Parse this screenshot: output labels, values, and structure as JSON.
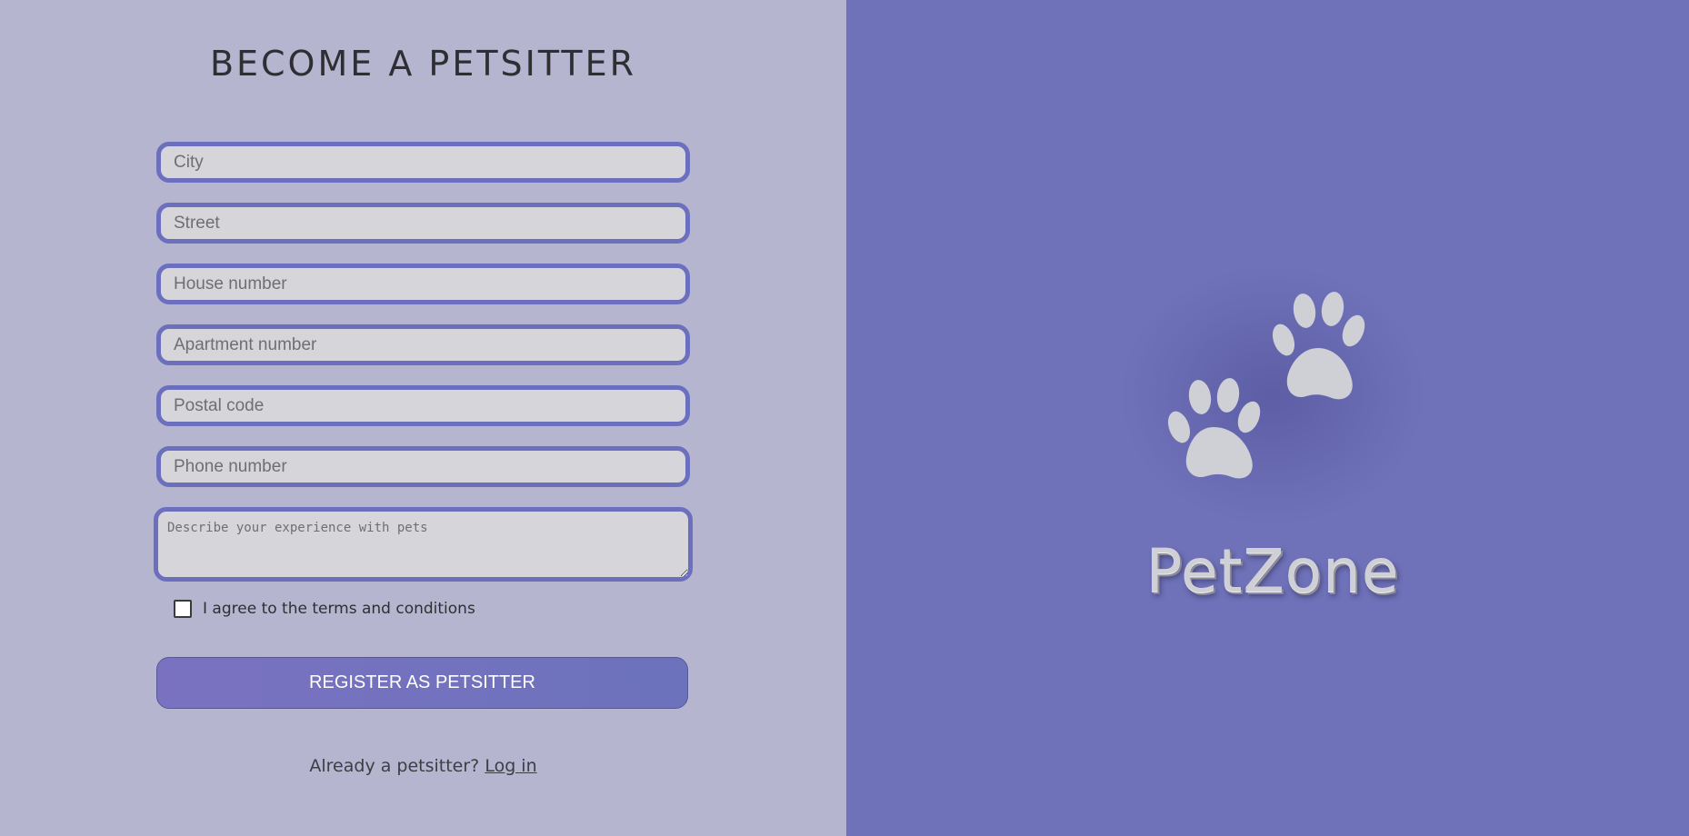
{
  "form": {
    "title": "BECOME A PETSITTER",
    "fields": {
      "city": "City",
      "street": "Street",
      "house_number": "House number",
      "apartment_number": "Apartment number",
      "postal_code": "Postal code",
      "phone_number": "Phone number",
      "experience": "Describe your experience with pets"
    },
    "terms_label": "I agree to the terms and conditions",
    "terms_checked": false,
    "register_label": "REGISTER AS PETSITTER",
    "already_text": "Already a petsitter?",
    "login_label": "Log in"
  },
  "brand": {
    "name": "PetZone",
    "icon": "paw-prints-icon"
  },
  "colors": {
    "left_bg": "#b5b5d0",
    "right_bg": "#6f71b9",
    "accent": "#6c6fbd",
    "input_bg": "#d6d6da"
  }
}
